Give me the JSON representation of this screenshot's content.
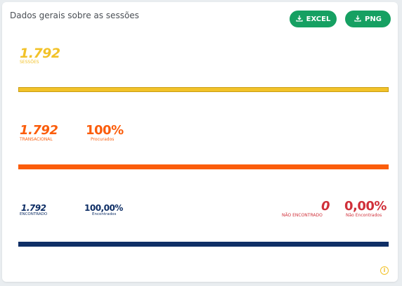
{
  "header": {
    "title": "Dados gerais sobre as sessões",
    "excel_label": "EXCEL",
    "png_label": "PNG"
  },
  "sessions": {
    "value": "1.792",
    "label": "SESSÕES"
  },
  "transactional": {
    "value": "1.792",
    "label": "TRANSACIONAL",
    "percent": "100%",
    "percent_label": "Procurados"
  },
  "found": {
    "value": "1.792",
    "label": "ENCONTRADO",
    "percent": "100,00%",
    "percent_label": "Encontrados"
  },
  "not_found": {
    "value": "0",
    "label": "NÃO ENCONTRADO",
    "percent": "0,00%",
    "percent_label": "Não Encontrados"
  },
  "colors": {
    "primary_button": "#16a062",
    "sessions": "#f2c229",
    "transactional": "#fb5d0b",
    "found": "#0f2f66",
    "not_found": "#d0303a",
    "info": "#f2c229"
  },
  "icons": {
    "download": "download-icon",
    "info": "info-icon"
  }
}
